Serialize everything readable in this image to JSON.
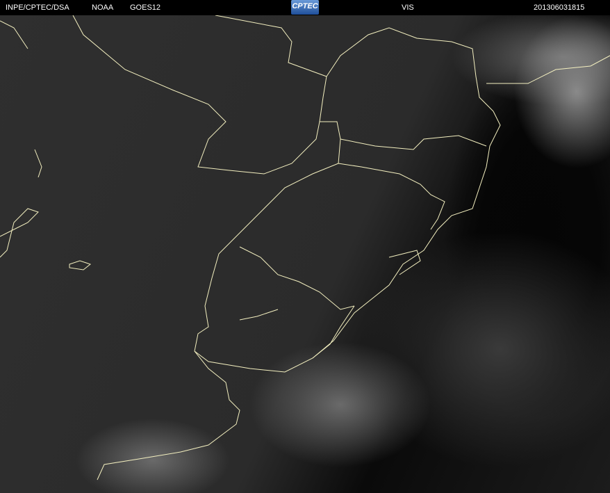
{
  "header": {
    "source": "INPE/CPTEC/DSA",
    "agency": "NOAA",
    "satellite": "GOES12",
    "logo_text": "CPTEC",
    "channel": "VIS",
    "timestamp": "201306031815"
  },
  "colors": {
    "border_line": "#f4f0c0",
    "header_bg": "#000000"
  }
}
